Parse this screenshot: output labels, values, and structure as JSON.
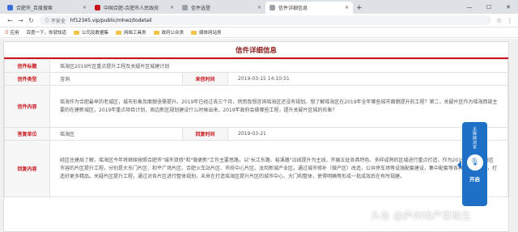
{
  "browser": {
    "tabs": [
      {
        "label": "合肥市_百度搜索",
        "favicon_color": "#3b6fd9"
      },
      {
        "label": "中国合肥-合肥市人民政府",
        "favicon_color": "#c8161d"
      },
      {
        "label": "信件选登",
        "favicon_color": "#9aa0a6"
      },
      {
        "label": "信件详细信息",
        "favicon_color": "#9aa0a6"
      }
    ],
    "new_tab": "+",
    "window_controls": [
      "—",
      "☐",
      "✕"
    ],
    "security": "ⓘ 不安全",
    "url": "hf12345.vip/public/mhwz/todetail",
    "bookmarks": [
      "应用",
      "百度一下，你就知道",
      "公司及数据集",
      "网络工具类",
      "政府公众类",
      "媒体网站类"
    ]
  },
  "page": {
    "title": "信件详细信息",
    "headline": "瑶海区2019片区重点提升工程及关疑片区城建计划",
    "rows": {
      "letter_title_label": "信件标题",
      "letter_type_label": "信件类型",
      "letter_type_value": "咨询",
      "letter_time_label": "来信时间",
      "letter_time_value": "2019-03-15 14:10:51",
      "letter_content_label": "信件内容",
      "letter_content_value": "瑶海作为合肥最早的老城区，城市形象及面貌亟需提升。2019年已经过去三个月，然而我想咨询瑶海区还没有规划。想了解瑶海区在2019年全年哪些城市面貌提升的工程？第二，关疑片区作为瑶海西部主要的在建新城区，2019年重点项目计划，周边新区规划建设什么时候出来，2019年政府会做哪些工程，提升关疑片区城的形象？",
      "reply_unit_label": "答复单位",
      "reply_unit_value": "瑶海区",
      "reply_time_label": "回复时间",
      "reply_time_value": "2019-03-21",
      "reply_content_label": "回复内容",
      "reply_content_value": "经区住建局了解，瑶海区今年将继续按照合肥市\"城市双修\"和\"微更新\"工作主要思路，以\"长江东路、裕溪路\"沿线提升为主线，开展五处各具特色、多样成熟的区域进行重点打造，作为2019年瑶海瑶海区市容的片区提升工程，分别是大东门片区、和平广场片区、合肥火车站片区、市府中心片区、龙岗新城产业区。通过城市修补（微产区）改造，公共停车场等设施配套建设，集中配套等各种项目的推进，打造好更多精品。关疑片区提升工程，通过对各片区进行整体规划，未来在打造瑶海区提升片区的城市中心、大门和整体，使得明确等形成一批成效后在有所规建。"
    },
    "voice_widget": {
      "text": "无障碍浏览",
      "button": "开启"
    },
    "watermark": "头条 @庐州地产百晓生"
  }
}
